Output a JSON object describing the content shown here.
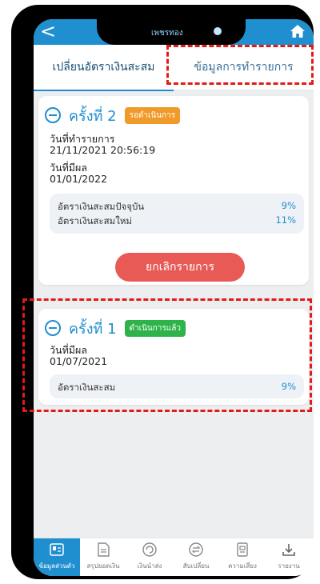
{
  "header": {
    "back_glyph": "<",
    "notch_title": "เพชรทอง"
  },
  "tabs": [
    {
      "label": "เปลี่ยนอัตราเงินสะสม",
      "active": true
    },
    {
      "label": "ข้อมูลการทำรายการ",
      "active": false
    }
  ],
  "card1": {
    "round_label": "ครั้งที่ 2",
    "status_badge": "รอดำเนินการ",
    "transaction_date_label": "วันที่ทำรายการ",
    "transaction_date_value": "21/11/2021 20:56:19",
    "effective_date_label": "วันที่มีผล",
    "effective_date_value": "01/01/2022",
    "rates": [
      {
        "label": "อัตราเงินสะสมปัจจุบัน",
        "value": "9%"
      },
      {
        "label": "อัตราเงินสะสมใหม่",
        "value": "11%"
      }
    ],
    "cancel_label": "ยกเลิกรายการ"
  },
  "card2": {
    "round_label": "ครั้งที่ 1",
    "status_badge": "ดำเนินการแล้ว",
    "effective_date_label": "วันที่มีผล",
    "effective_date_value": "01/07/2021",
    "rate_label": "อัตราเงินสะสม",
    "rate_value": "9%"
  },
  "bottom_nav": [
    {
      "label": "ข้อมูลส่วนตัว",
      "icon": "profile-card-icon",
      "active": true
    },
    {
      "label": "สรุปยอดเงิน",
      "icon": "document-icon",
      "active": false
    },
    {
      "label": "เงินนำส่ง",
      "icon": "refresh-circle-icon",
      "active": false
    },
    {
      "label": "สับเปลี่ยน",
      "icon": "exchange-icon",
      "active": false
    },
    {
      "label": "ความเสี่ยง",
      "icon": "risk-document-icon",
      "active": false
    },
    {
      "label": "รายงาน",
      "icon": "download-icon",
      "active": false
    }
  ],
  "colors": {
    "primary": "#1f8fcf",
    "pending": "#f09a2a",
    "done": "#2db34a",
    "cancel": "#e85a55",
    "annotation": "#e21a1a"
  }
}
